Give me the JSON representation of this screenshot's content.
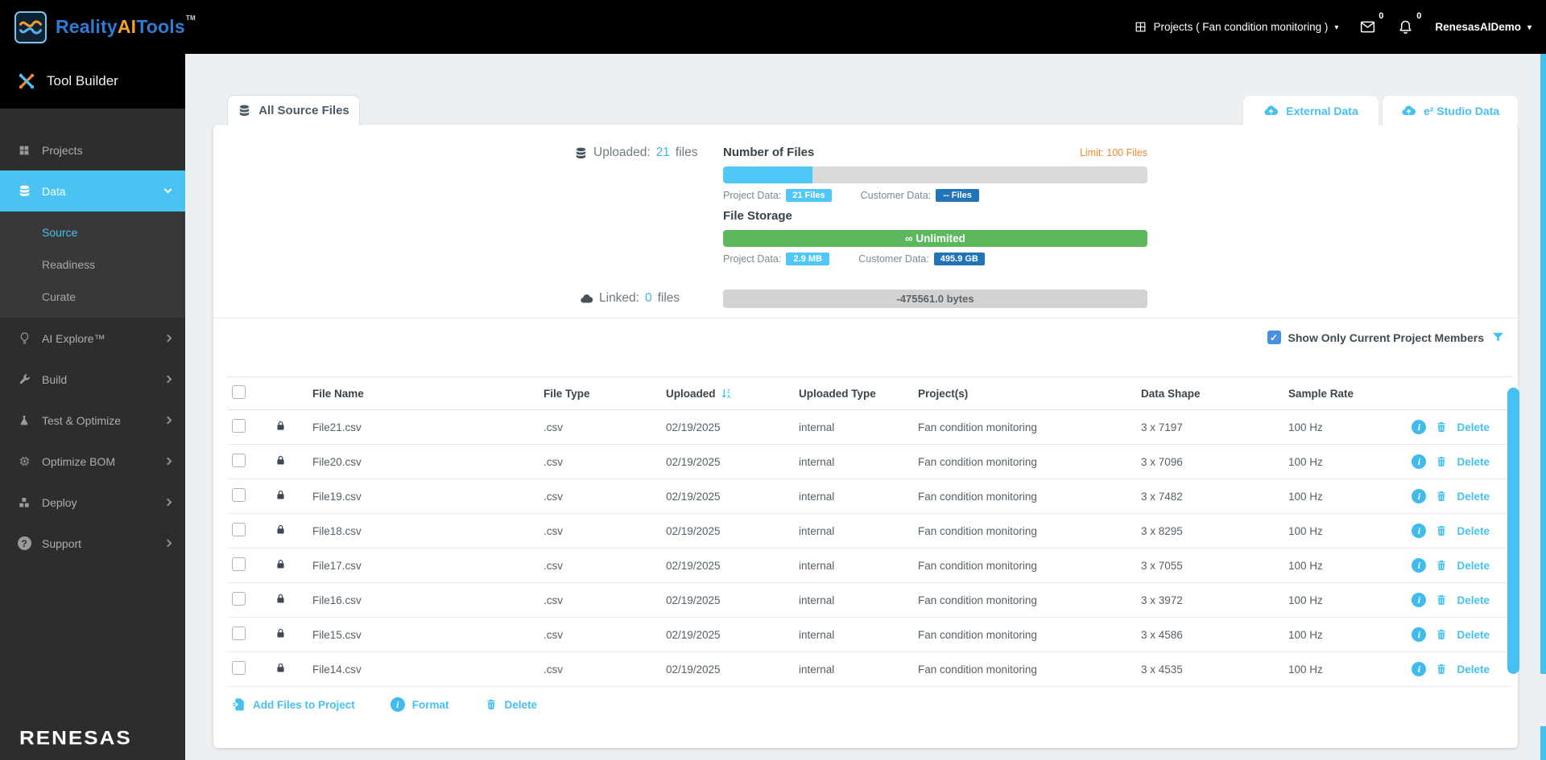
{
  "header": {
    "logo_reality": "Reality",
    "logo_ai": "AI",
    "logo_tools": "Tools",
    "logo_tm": "TM",
    "projects_menu": "Projects ( Fan condition monitoring )",
    "mail_count": "0",
    "notification_count": "0",
    "user_menu": "RenesasAIDemo"
  },
  "sidebar": {
    "tool_builder": "Tool Builder",
    "items": [
      {
        "label": "Projects"
      },
      {
        "label": "Data"
      },
      {
        "label": "AI Explore™"
      },
      {
        "label": "Build"
      },
      {
        "label": "Test & Optimize"
      },
      {
        "label": "Optimize BOM"
      },
      {
        "label": "Deploy"
      },
      {
        "label": "Support"
      }
    ],
    "subitems": [
      {
        "label": "Source"
      },
      {
        "label": "Readiness"
      },
      {
        "label": "Curate"
      }
    ],
    "brand": "RENESAS"
  },
  "tabs": {
    "all_source_files": "All Source Files",
    "external_data": "External Data",
    "studio_data": "e² Studio Data"
  },
  "stats": {
    "uploaded_label": "Uploaded:",
    "uploaded_count": "21",
    "uploaded_suffix": "files",
    "linked_label": "Linked:",
    "linked_count": "0",
    "linked_suffix": "files",
    "number_of_files": {
      "title": "Number of Files",
      "limit": "Limit: 100 Files",
      "percent": 21,
      "project_data_label": "Project Data:",
      "project_badge": "21 Files",
      "customer_data_label": "Customer Data:",
      "customer_badge": "-- Files"
    },
    "file_storage": {
      "title": "File Storage",
      "bar_label": "∞ Unlimited",
      "project_data_label": "Project Data:",
      "project_badge": "2.9 MB",
      "customer_data_label": "Customer Data:",
      "customer_badge": "495.9 GB"
    },
    "bytes_bar": "-475561.0 bytes"
  },
  "filter": {
    "label": "Show Only Current Project Members"
  },
  "table": {
    "columns": [
      "File Name",
      "File Type",
      "Uploaded",
      "Uploaded Type",
      "Project(s)",
      "Data Shape",
      "Sample Rate"
    ],
    "delete_label": "Delete",
    "rows": [
      {
        "name": "File21.csv",
        "type": ".csv",
        "uploaded": "02/19/2025",
        "uploaded_type": "internal",
        "projects": "Fan condition monitoring",
        "shape": "3 x 7197",
        "rate": "100 Hz"
      },
      {
        "name": "File20.csv",
        "type": ".csv",
        "uploaded": "02/19/2025",
        "uploaded_type": "internal",
        "projects": "Fan condition monitoring",
        "shape": "3 x 7096",
        "rate": "100 Hz"
      },
      {
        "name": "File19.csv",
        "type": ".csv",
        "uploaded": "02/19/2025",
        "uploaded_type": "internal",
        "projects": "Fan condition monitoring",
        "shape": "3 x 7482",
        "rate": "100 Hz"
      },
      {
        "name": "File18.csv",
        "type": ".csv",
        "uploaded": "02/19/2025",
        "uploaded_type": "internal",
        "projects": "Fan condition monitoring",
        "shape": "3 x 8295",
        "rate": "100 Hz"
      },
      {
        "name": "File17.csv",
        "type": ".csv",
        "uploaded": "02/19/2025",
        "uploaded_type": "internal",
        "projects": "Fan condition monitoring",
        "shape": "3 x 7055",
        "rate": "100 Hz"
      },
      {
        "name": "File16.csv",
        "type": ".csv",
        "uploaded": "02/19/2025",
        "uploaded_type": "internal",
        "projects": "Fan condition monitoring",
        "shape": "3 x 3972",
        "rate": "100 Hz"
      },
      {
        "name": "File15.csv",
        "type": ".csv",
        "uploaded": "02/19/2025",
        "uploaded_type": "internal",
        "projects": "Fan condition monitoring",
        "shape": "3 x 4586",
        "rate": "100 Hz"
      },
      {
        "name": "File14.csv",
        "type": ".csv",
        "uploaded": "02/19/2025",
        "uploaded_type": "internal",
        "projects": "Fan condition monitoring",
        "shape": "3 x 4535",
        "rate": "100 Hz"
      }
    ]
  },
  "actions": {
    "add_files": "Add Files to Project",
    "format": "Format",
    "delete": "Delete"
  },
  "icons": {
    "caret_down": "▾",
    "check": "✓",
    "question": "?",
    "info": "i"
  },
  "colors": {
    "accent": "#45c1f1",
    "dark_blue": "#2274b9",
    "green": "#5cb85c",
    "orange": "#ef8829"
  }
}
